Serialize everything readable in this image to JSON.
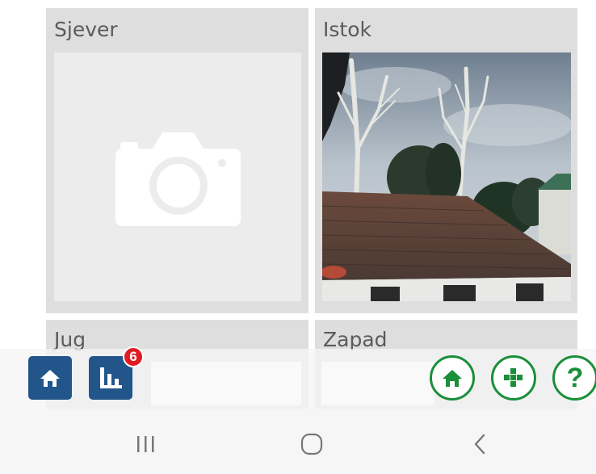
{
  "tiles": {
    "north": {
      "label": "Sjever"
    },
    "east": {
      "label": "Istok"
    },
    "south": {
      "label": "Jug"
    },
    "west": {
      "label": "Zapad"
    }
  },
  "toolbar": {
    "home_icon": "home-icon",
    "stats_icon": "bar-chart-icon",
    "stats_badge": "6",
    "round_home_icon": "home-icon",
    "round_grid_icon": "grid-icon",
    "help_label": "?"
  },
  "colors": {
    "square_button": "#22568a",
    "round_button_accent": "#1a8f3a",
    "badge": "#e01b22",
    "tile_background": "#dedede"
  }
}
